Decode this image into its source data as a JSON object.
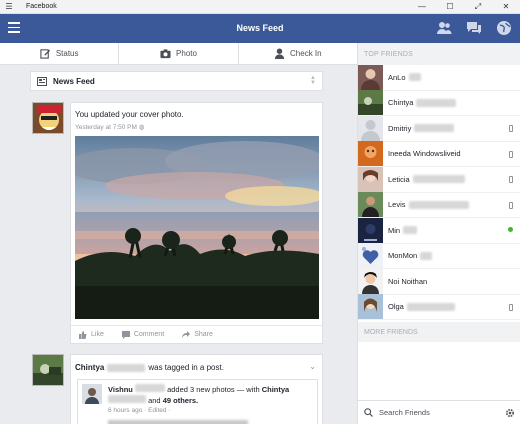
{
  "window": {
    "title": "Facebook"
  },
  "header": {
    "title": "News Feed"
  },
  "compose": {
    "status": "Status",
    "photo": "Photo",
    "checkin": "Check In"
  },
  "feed_selector": {
    "label": "News Feed"
  },
  "post1": {
    "text": "You updated your cover photo.",
    "meta": "Yesterday at 7:50 PM",
    "actions": {
      "like": "Like",
      "comment": "Comment",
      "share": "Share"
    }
  },
  "post2": {
    "author": "Chintya",
    "action_text": "was tagged in a post.",
    "inner_author": "Vishnu",
    "inner_text_a": "added 3 new photos — with",
    "inner_tag": "Chintya",
    "inner_text_b": "and",
    "inner_others": "49 others.",
    "inner_meta": "6 hours ago · Edited ·"
  },
  "sidebar": {
    "top_friends_label": "TOP FRIENDS",
    "more_friends_label": "MORE FRIENDS",
    "search_label": "Search Friends",
    "friends": [
      {
        "name": "AnLo",
        "status": "none"
      },
      {
        "name": "Chintya",
        "status": "none"
      },
      {
        "name": "Dmitriy",
        "status": "mobile"
      },
      {
        "name": "Ineeda Windowsliveid",
        "status": "mobile"
      },
      {
        "name": "Leticia",
        "status": "mobile"
      },
      {
        "name": "Levis",
        "status": "mobile"
      },
      {
        "name": "Min",
        "status": "online"
      },
      {
        "name": "MonMon",
        "status": "none"
      },
      {
        "name": "Noi Noithan",
        "status": "none"
      },
      {
        "name": "Olga",
        "status": "mobile"
      }
    ]
  },
  "colors": {
    "brand": "#3b5998",
    "online": "#42b72a"
  }
}
